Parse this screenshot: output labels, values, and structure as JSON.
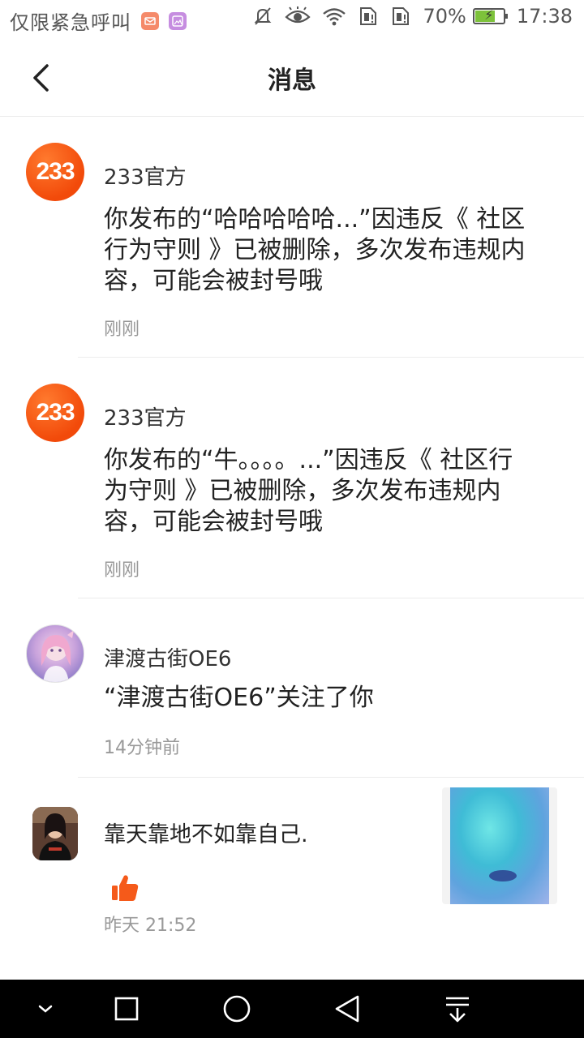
{
  "status_bar": {
    "carrier": "仅限紧急呼叫",
    "battery_percent": "70%",
    "battery_level": 0.7,
    "time": "17:38",
    "icons": [
      "notification-app-icon",
      "gallery-app-icon",
      "mute-icon",
      "eye-care-icon",
      "wifi-icon",
      "sim1-icon",
      "sim2-icon",
      "battery-icon"
    ]
  },
  "header": {
    "title": "消息",
    "back_icon": "back-arrow-icon"
  },
  "messages": [
    {
      "sender": "233官方",
      "avatar_text": "233",
      "content": "你发布的“哈哈哈哈哈...”因违反《 社区行为守则 》已被删除，多次发布违规内容，可能会被封号哦",
      "time": "刚刚"
    },
    {
      "sender": "233官方",
      "avatar_text": "233",
      "content": "你发布的“牛。。。。...”因违反《 社区行为守则 》已被删除，多次发布违规内容，可能会被封号哦",
      "time": "刚刚"
    },
    {
      "sender": "津渡古街OE6",
      "content": "“津渡古街OE6”关注了你",
      "time": "14分钟前"
    },
    {
      "content": "靠天靠地不如靠自己.",
      "time": "昨天 21:52",
      "like_icon": "thumbs-up-icon",
      "thumbnail": "post-thumbnail"
    }
  ],
  "nav_bar": {
    "icons": [
      "collapse-icon",
      "recent-apps-icon",
      "home-icon",
      "back-icon",
      "pull-down-icon"
    ]
  },
  "colors": {
    "accent": "#f24a0a",
    "like": "#f55a1a",
    "time_text": "#999999"
  }
}
